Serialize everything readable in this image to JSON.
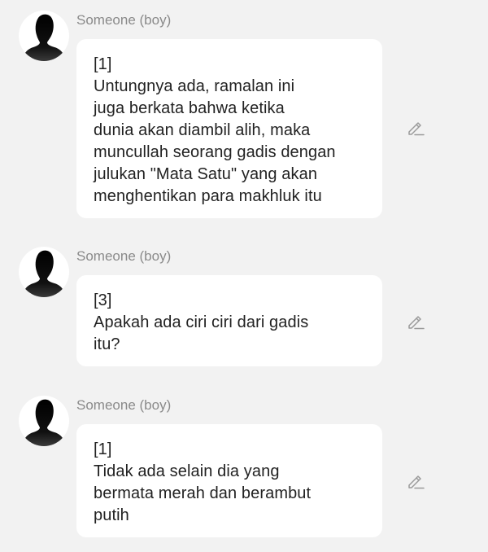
{
  "colors": {
    "background": "#f2f2f2",
    "bubble": "#ffffff",
    "sender_text": "#8a8a8a",
    "message_text": "#222222",
    "edit_icon": "#9a9a9a"
  },
  "messages": [
    {
      "avatar_icon": "person-silhouette-icon",
      "sender": "Someone (boy)",
      "lines": [
        "[1]",
        "Untungnya ada, ramalan ini",
        "juga berkata bahwa ketika",
        "dunia akan diambil alih, maka",
        "muncullah seorang gadis dengan",
        "julukan \"Mata Satu\" yang akan",
        "menghentikan para makhluk itu"
      ],
      "edit_icon": "pencil-edit-icon"
    },
    {
      "avatar_icon": "person-silhouette-icon",
      "sender": "Someone (boy)",
      "lines": [
        "[3]",
        "Apakah ada ciri ciri dari gadis",
        "itu?"
      ],
      "edit_icon": "pencil-edit-icon"
    },
    {
      "avatar_icon": "person-silhouette-icon",
      "sender": "Someone (boy)",
      "lines": [
        "[1]",
        "Tidak ada selain dia yang",
        "bermata merah dan berambut",
        "putih"
      ],
      "edit_icon": "pencil-edit-icon"
    }
  ]
}
